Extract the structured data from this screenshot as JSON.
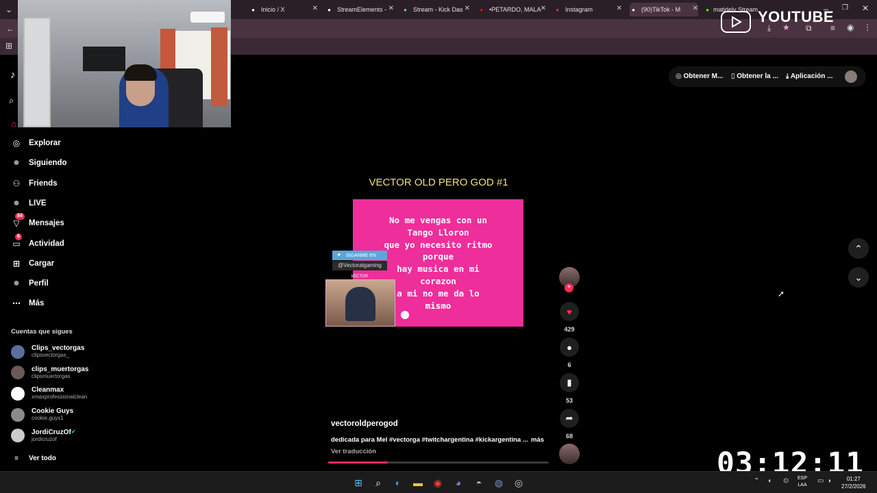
{
  "browser": {
    "tabs": [
      {
        "label": "Inicio / X",
        "icon": "x-logo-icon",
        "color": "#ffffff"
      },
      {
        "label": "StreamElements -",
        "icon": "streamelements-icon",
        "color": "#ffffff"
      },
      {
        "label": "Stream - Kick Das",
        "icon": "kick-icon",
        "color": "#53fc18"
      },
      {
        "label": "•PETARDO, MALA",
        "icon": "youtube-icon",
        "color": "#ff0000"
      },
      {
        "label": "Instagram",
        "icon": "instagram-icon",
        "color": "#e1306c"
      },
      {
        "label": "(90)TikTok - M",
        "icon": "tiktok-icon",
        "color": "#ffffff",
        "active": true
      },
      {
        "label": "matidelv Stream",
        "icon": "kick-icon",
        "color": "#53fc18"
      }
    ]
  },
  "overlay": {
    "youtube_label": "YOUTUBE",
    "timer": "03:12:11"
  },
  "sidebar": {
    "nav": [
      {
        "label": "Explorar",
        "icon": "compass-icon"
      },
      {
        "label": "Siguiendo",
        "icon": "following-avatar-icon"
      },
      {
        "label": "Friends",
        "icon": "friends-icon"
      },
      {
        "label": "LIVE",
        "icon": "live-avatar-icon"
      },
      {
        "label": "Mensajes",
        "icon": "messages-icon",
        "badge": "84"
      },
      {
        "label": "Actividad",
        "icon": "activity-icon",
        "badge": "6"
      },
      {
        "label": "Cargar",
        "icon": "upload-icon"
      },
      {
        "label": "Perfil",
        "icon": "profile-avatar-icon"
      },
      {
        "label": "Más",
        "icon": "more-icon"
      }
    ],
    "following_title": "Cuentas que sigues",
    "following": [
      {
        "name": "Clips_vectorgas",
        "handle": "clipsvectorgas_"
      },
      {
        "name": "clips_muertorgas",
        "handle": "clipsmuertorgas"
      },
      {
        "name": "Cleanmax",
        "handle": "xmaxprofessionalclean"
      },
      {
        "name": "Cookie Guys",
        "handle": "cookie.guys1"
      },
      {
        "name": "JordiCruzOf",
        "handle": "jordicruzof",
        "verified": true
      }
    ],
    "see_all": "Ver todo"
  },
  "top_actions": {
    "get_coins": "Obtener M...",
    "get_app": "Obtener la ...",
    "download_app": "Aplicación ..."
  },
  "video": {
    "title": "VECTOR OLD PERO GOD #1",
    "lyrics": [
      "No me vengas con un",
      "Tango Lloron",
      "que yo necesito ritmo",
      "porque",
      "hay musica en mi",
      "corazon",
      "a mi no me da lo",
      "mismo"
    ],
    "twitter_tag": "SIGANME EN",
    "twitter_handle": "@Vectoratgaming",
    "cam_label": "VECTOR",
    "author": "vectoroldperogod",
    "description": "dedicada para Mel #vectorga #twitchargentina #kickargentina ...",
    "more_label": "más",
    "translate_label": "Ver traducción",
    "progress": 0.27,
    "likes": "429",
    "comments": "6",
    "saves": "53",
    "shares": "68"
  },
  "taskbar": {
    "lang_line1": "ESP",
    "lang_line2": "LAA",
    "time": "01:27",
    "date": "27/2/2026"
  }
}
